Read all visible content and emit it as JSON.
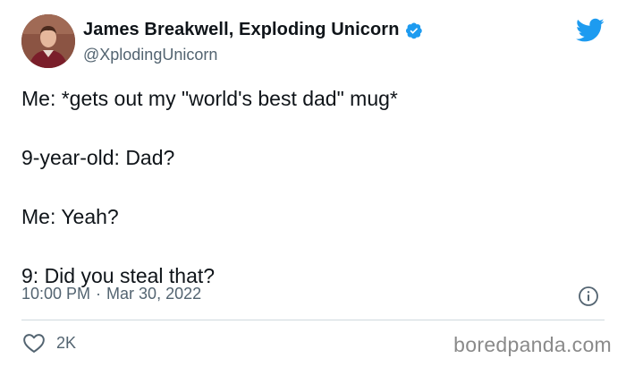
{
  "author": {
    "display_name": "James Breakwell, Exploding Unicorn",
    "handle": "@XplodingUnicorn",
    "verified": true
  },
  "tweet": {
    "lines": [
      "Me: *gets out my \"world's best dad\" mug*",
      "9-year-old: Dad?",
      "Me: Yeah?",
      "9: Did you steal that?"
    ],
    "time": "10:00 PM",
    "separator": "·",
    "date": "Mar 30, 2022"
  },
  "engagement": {
    "likes": "2K"
  },
  "watermark": "boredpanda.com",
  "icons": {
    "verified": "verified-badge-icon",
    "brand": "twitter-bird-icon",
    "info": "info-icon",
    "like": "heart-icon"
  },
  "colors": {
    "primary_text": "#0f1419",
    "secondary_text": "#536471",
    "twitter_blue": "#1d9bf0",
    "divider": "#cfd9de",
    "watermark": "#8a8a8a"
  }
}
